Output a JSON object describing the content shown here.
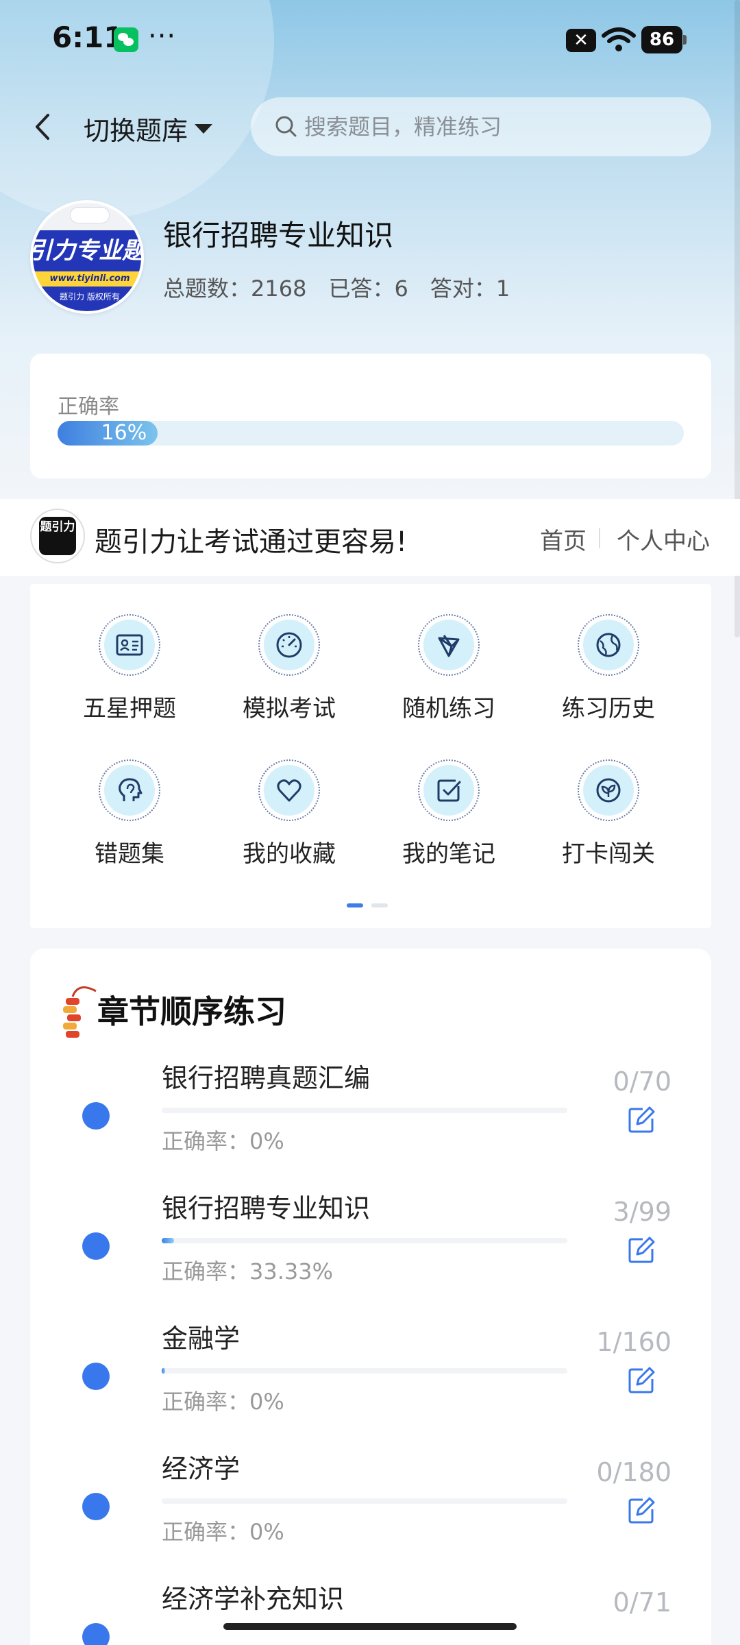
{
  "status_bar": {
    "time": "6:11",
    "more": "···",
    "battery": "86",
    "sim_icon": "sim-x-icon",
    "wifi_icon": "wifi-icon"
  },
  "header": {
    "switch_label": "切换题库",
    "search_placeholder": "搜索题目，精准练习"
  },
  "course": {
    "title": "银行招聘专业知识",
    "logo_text": "引力专业题",
    "logo_url": "www.tiyinli.com",
    "logo_footer": "题引力 版权所有",
    "logo_badge": "题引力",
    "stats": [
      "总题数：2168",
      "已答：6",
      "答对：1"
    ]
  },
  "accuracy": {
    "label": "正确率",
    "value_text": "16%",
    "value": 0.16
  },
  "brand": {
    "logo_text": "题引力",
    "slogan": "题引力让考试通过更容易!",
    "nav_home": "首页",
    "nav_user": "个人中心"
  },
  "features": [
    {
      "label": "五星押题",
      "icon": "id-card-icon"
    },
    {
      "label": "模拟考试",
      "icon": "gauge-icon"
    },
    {
      "label": "随机练习",
      "icon": "network-icon"
    },
    {
      "label": "练习历史",
      "icon": "globe-icon"
    },
    {
      "label": "错题集",
      "icon": "head-icon"
    },
    {
      "label": "我的收藏",
      "icon": "heart-icon"
    },
    {
      "label": "我的笔记",
      "icon": "note-check-icon"
    },
    {
      "label": "打卡闯关",
      "icon": "leaf-icon"
    }
  ],
  "chapters_section": {
    "title": "章节顺序练习"
  },
  "chapters": [
    {
      "name": "银行招聘真题汇编",
      "rate": "正确率：0%",
      "count": "0/70",
      "progress": 0
    },
    {
      "name": "银行招聘专业知识",
      "rate": "正确率：33.33%",
      "count": "3/99",
      "progress": 0.0303
    },
    {
      "name": "金融学",
      "rate": "正确率：0%",
      "count": "1/160",
      "progress": 0.00625
    },
    {
      "name": "经济学",
      "rate": "正确率：0%",
      "count": "0/180",
      "progress": 0
    },
    {
      "name": "经济学补充知识",
      "rate": "",
      "count": "0/71",
      "progress": 0
    }
  ],
  "colors": {
    "accent": "#3978ec",
    "icon_bg": "#d4f0fb",
    "logo_blue": "#2336b8",
    "logo_yellow": "#ffd43a"
  }
}
